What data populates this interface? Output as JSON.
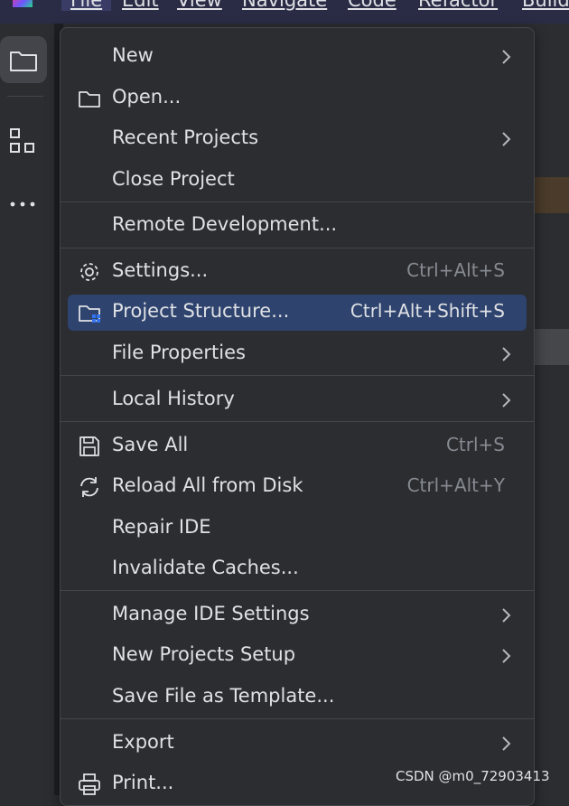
{
  "menubar": {
    "items": [
      "File",
      "Edit",
      "View",
      "Navigate",
      "Code",
      "Refactor",
      "Build"
    ]
  },
  "file_menu": {
    "items": [
      {
        "label": "New",
        "submenu": true
      },
      {
        "label": "Open...",
        "icon": "folder-icon"
      },
      {
        "label": "Recent Projects",
        "submenu": true
      },
      {
        "label": "Close Project"
      },
      {
        "label": "Remote Development..."
      },
      {
        "label": "Settings...",
        "icon": "gear-icon",
        "shortcut": "Ctrl+Alt+S"
      },
      {
        "label": "Project Structure...",
        "icon": "project-structure-icon",
        "shortcut": "Ctrl+Alt+Shift+S",
        "highlighted": true
      },
      {
        "label": "File Properties",
        "submenu": true
      },
      {
        "label": "Local History",
        "submenu": true
      },
      {
        "label": "Save All",
        "icon": "save-icon",
        "shortcut": "Ctrl+S"
      },
      {
        "label": "Reload All from Disk",
        "icon": "reload-icon",
        "shortcut": "Ctrl+Alt+Y"
      },
      {
        "label": "Repair IDE"
      },
      {
        "label": "Invalidate Caches..."
      },
      {
        "label": "Manage IDE Settings",
        "submenu": true
      },
      {
        "label": "New Projects Setup",
        "submenu": true
      },
      {
        "label": "Save File as Template..."
      },
      {
        "label": "Export",
        "submenu": true
      },
      {
        "label": "Print...",
        "icon": "print-icon"
      }
    ]
  },
  "watermark": "CSDN @m0_72903413",
  "colors": {
    "menu_bg": "#2b2d30",
    "highlight": "#2e436e",
    "text": "#dfe1e5",
    "shortcut_text": "#868a91"
  }
}
